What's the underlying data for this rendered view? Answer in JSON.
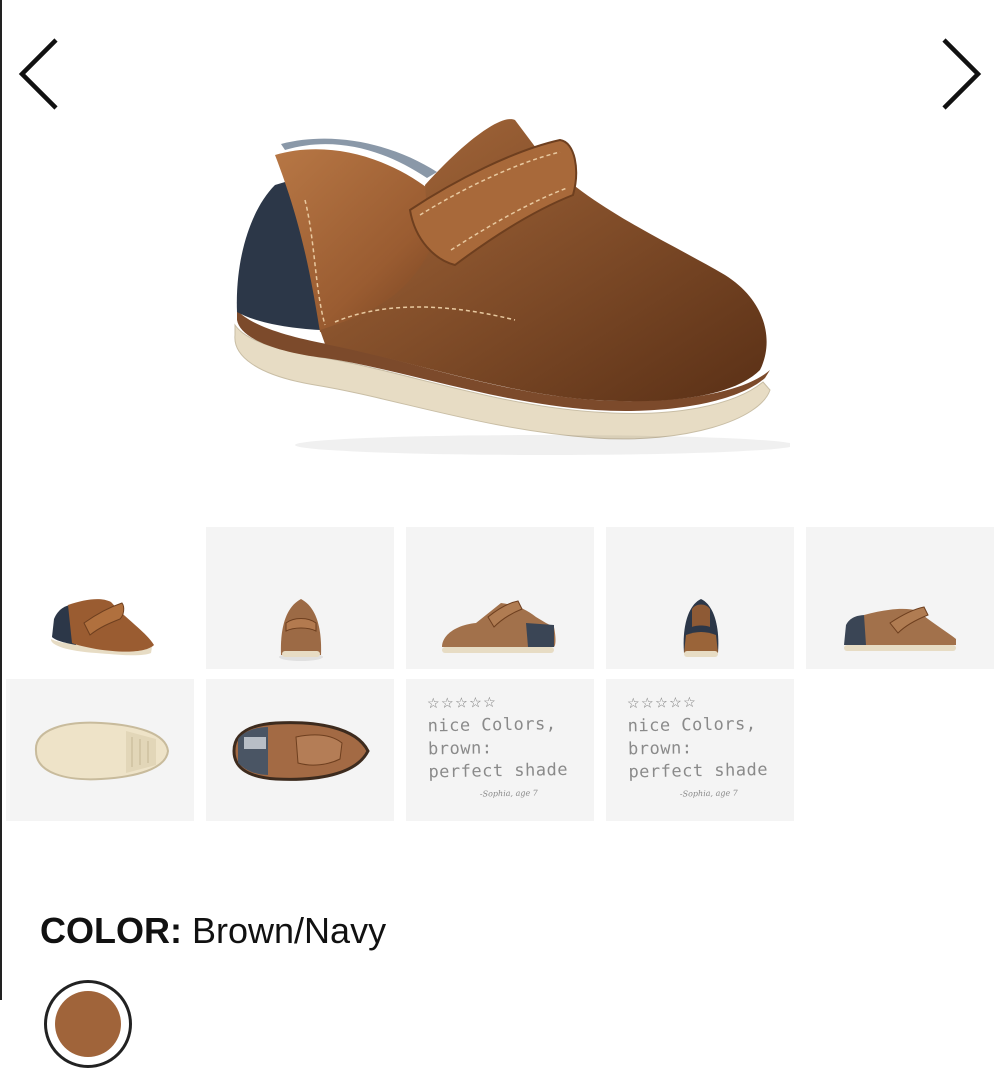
{
  "gallery": {
    "prev_icon": "chevron-left-icon",
    "next_icon": "chevron-right-icon",
    "thumbnails": [
      {
        "view": "angle-view",
        "selected": true
      },
      {
        "view": "front-view",
        "selected": false
      },
      {
        "view": "side-view",
        "selected": false
      },
      {
        "view": "back-view",
        "selected": false
      },
      {
        "view": "inner-side-view",
        "selected": false
      },
      {
        "view": "sole-view",
        "selected": false
      },
      {
        "view": "top-view",
        "selected": false
      },
      {
        "view": "review-card",
        "selected": false
      },
      {
        "view": "review-card",
        "selected": false
      }
    ]
  },
  "review": {
    "stars": "☆☆☆☆☆",
    "line1": "nice Colors,",
    "line2": "brown:",
    "line3": "perfect shade",
    "signature": "-Sophia, age 7"
  },
  "product": {
    "color_label": "COLOR:",
    "color_value": "Brown/Navy"
  },
  "colors": {
    "leather": "#a0643a",
    "navy_suede": "#2c3748",
    "sole": "#e7dcc4",
    "thumb_bg": "#f4f4f4"
  }
}
